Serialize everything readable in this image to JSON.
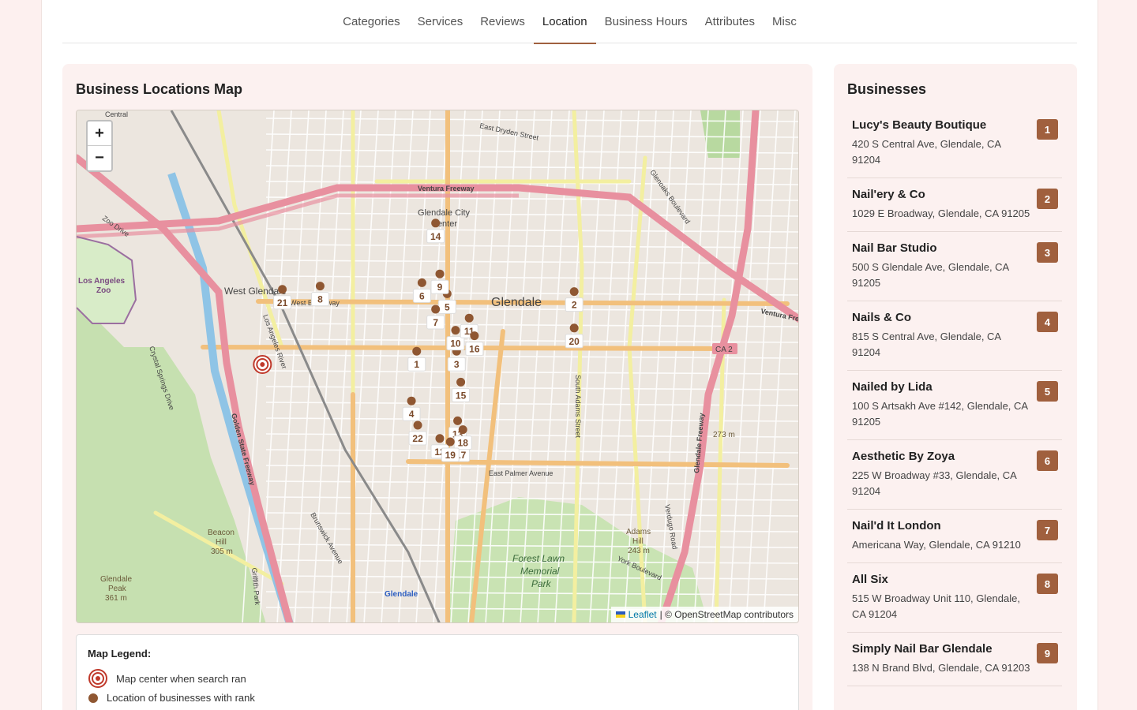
{
  "tabs": [
    "Categories",
    "Services",
    "Reviews",
    "Location",
    "Business Hours",
    "Attributes",
    "Misc"
  ],
  "active_tab": "Location",
  "map_card": {
    "title": "Business Locations Map"
  },
  "businesses_card": {
    "title": "Businesses"
  },
  "zoom": {
    "in_label": "+",
    "out_label": "−"
  },
  "attribution": {
    "leaflet": "Leaflet",
    "osm": "| © OpenStreetMap contributors"
  },
  "map_labels": {
    "glendale": "Glendale",
    "civic_center_1": "Glendale City",
    "civic_center_2": "Center",
    "west_glendale": "West Glendale",
    "west_broadway": "West Broadway",
    "zoo_1": "Los Angeles",
    "zoo_2": "Zoo",
    "zoo_drive": "Zoo Drive",
    "ventura_freeway": "Ventura Freeway",
    "ventura_fre": "Ventura Fre",
    "east_dryden": "East Dryden Street",
    "glenoaks": "Glenoaks Boulevard",
    "east_palmer": "East Palmer Avenue",
    "south_adams": "South Adams Street",
    "glendale_freeway": "Glendale Freeway",
    "golden_state": "Golden State Freeway",
    "crystal_springs": "Crystal Springs Drive",
    "forest_lawn_1": "Forest Lawn",
    "forest_lawn_2": "Memorial",
    "forest_lawn_3": "Park",
    "adams_hill_1": "Adams",
    "adams_hill_2": "Hill",
    "adams_hill_3": "243 m",
    "beacon_1": "Beacon",
    "beacon_2": "Hill",
    "beacon_3": "305 m",
    "peak_1": "Glendale",
    "peak_2": "Peak",
    "peak_3": "361 m",
    "verdugo": "Verdugo Road",
    "york": "York Boulevard",
    "brunswick": "Brunswick Avenue",
    "griffith": "Griffith Park",
    "elev_273": "273 m",
    "ca2": "CA 2",
    "glendale_station": "Glendale",
    "central": "Central",
    "la_river": "Los Angeles River"
  },
  "map_center": {
    "lat": 34.1425,
    "lng": -118.27
  },
  "markers": [
    {
      "rank": 1,
      "lat": 34.1437,
      "lng": -118.2553
    },
    {
      "rank": 2,
      "lat": 34.1491,
      "lng": -118.2403
    },
    {
      "rank": 3,
      "lat": 34.1437,
      "lng": -118.2515
    },
    {
      "rank": 4,
      "lat": 34.1392,
      "lng": -118.2558
    },
    {
      "rank": 5,
      "lat": 34.1489,
      "lng": -118.2524
    },
    {
      "rank": 6,
      "lat": 34.1499,
      "lng": -118.2548
    },
    {
      "rank": 7,
      "lat": 34.1475,
      "lng": -118.2535
    },
    {
      "rank": 8,
      "lat": 34.1496,
      "lng": -118.2645
    },
    {
      "rank": 9,
      "lat": 34.1507,
      "lng": -118.2531
    },
    {
      "rank": 10,
      "lat": 34.1456,
      "lng": -118.2516
    },
    {
      "rank": 11,
      "lat": 34.1467,
      "lng": -118.2503
    },
    {
      "rank": 12,
      "lat": 34.1358,
      "lng": -118.2531
    },
    {
      "rank": 13,
      "lat": 34.1374,
      "lng": -118.2514
    },
    {
      "rank": 14,
      "lat": 34.1553,
      "lng": -118.2535
    },
    {
      "rank": 15,
      "lat": 34.1409,
      "lng": -118.2511
    },
    {
      "rank": 16,
      "lat": 34.1451,
      "lng": -118.2498
    },
    {
      "rank": 17,
      "lat": 34.1355,
      "lng": -118.2511
    },
    {
      "rank": 18,
      "lat": 34.1366,
      "lng": -118.2509
    },
    {
      "rank": 19,
      "lat": 34.1355,
      "lng": -118.2521
    },
    {
      "rank": 20,
      "lat": 34.1458,
      "lng": -118.2403
    },
    {
      "rank": 21,
      "lat": 34.1493,
      "lng": -118.2681
    },
    {
      "rank": 22,
      "lat": 34.137,
      "lng": -118.2552
    }
  ],
  "legend": {
    "title": "Map Legend:",
    "center_label": "Map center when search ran",
    "business_label": "Location of businesses with rank"
  },
  "businesses": [
    {
      "rank": "1",
      "name": "Lucy's Beauty Boutique",
      "address": "420 S Central Ave, Glendale, CA 91204"
    },
    {
      "rank": "2",
      "name": "Nail'ery & Co",
      "address": "1029 E Broadway, Glendale, CA 91205"
    },
    {
      "rank": "3",
      "name": "Nail Bar Studio",
      "address": "500 S Glendale Ave, Glendale, CA 91205"
    },
    {
      "rank": "4",
      "name": "Nails & Co",
      "address": "815 S Central Ave, Glendale, CA 91204"
    },
    {
      "rank": "5",
      "name": "Nailed by Lida",
      "address": "100 S Artsakh Ave #142, Glendale, CA 91205"
    },
    {
      "rank": "6",
      "name": "Aesthetic By Zoya",
      "address": "225 W Broadway #33, Glendale, CA 91204"
    },
    {
      "rank": "7",
      "name": "Nail'd It London",
      "address": "Americana Way, Glendale, CA 91210"
    },
    {
      "rank": "8",
      "name": "All Six",
      "address": "515 W Broadway Unit 110, Glendale, CA 91204"
    },
    {
      "rank": "9",
      "name": "Simply Nail Bar Glendale",
      "address": "138 N Brand Blvd, Glendale, CA 91203"
    }
  ],
  "colors": {
    "accent": "#a0603e",
    "marker": "#8f5732",
    "center": "#c0392b",
    "motorway": "#e8909f",
    "primary": "#f7c981",
    "secondary": "#f5f2a6",
    "park": "#c9e3b3"
  }
}
